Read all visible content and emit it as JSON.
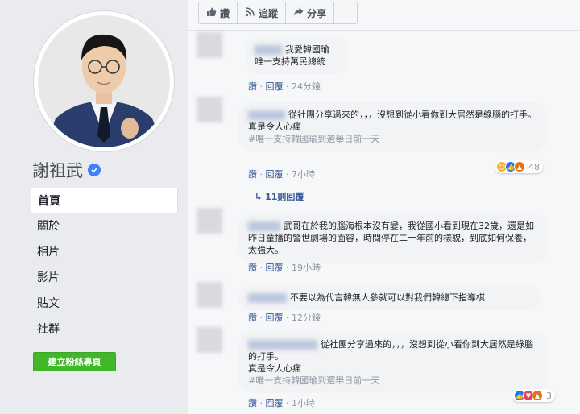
{
  "page": {
    "name": "謝祖武",
    "nav": [
      "首頁",
      "關於",
      "相片",
      "影片",
      "貼文",
      "社群"
    ],
    "create_button": "建立粉絲專頁"
  },
  "actions": {
    "like": "讚",
    "follow": "追蹤",
    "share": "分享"
  },
  "comment_labels": {
    "like": "讚",
    "reply": "回覆"
  },
  "comments": [
    {
      "text": "我愛韓國瑜\n唯一支持萬民總統",
      "time": "24分鐘"
    },
    {
      "text": "從社團分享過來的，，，沒想到從小看你到大居然是綠腦的打手。\n真是令人心痛",
      "hashtag": "#唯一支持韓國瑜到選舉日前一天",
      "time": "7小時",
      "reactions": "48",
      "replies": "11則回覆"
    },
    {
      "text": "武哥在於我的腦海根本沒有變，我從國小看到現在32歲，還是如昨日童播的警世劇場的面容，時間停在二十年前的樣貌，到底如何保養，太強大。",
      "time": "19小時"
    },
    {
      "text": "不要以為代言韓無人參就可以對我們韓總下指導棋",
      "time": "12分鐘"
    },
    {
      "text": "從社團分享過來的，，，沒想到從小看你到大居然是綠腦的打手。\n真是令人心痛",
      "hashtag": "#唯一支持韓國瑜到選舉日前一天",
      "time": "1小時",
      "reactions": "3"
    }
  ],
  "colors": {
    "link": "#385898",
    "create_button": "#42b72a",
    "verified": "#4080ff",
    "background": "#e9ebee"
  }
}
